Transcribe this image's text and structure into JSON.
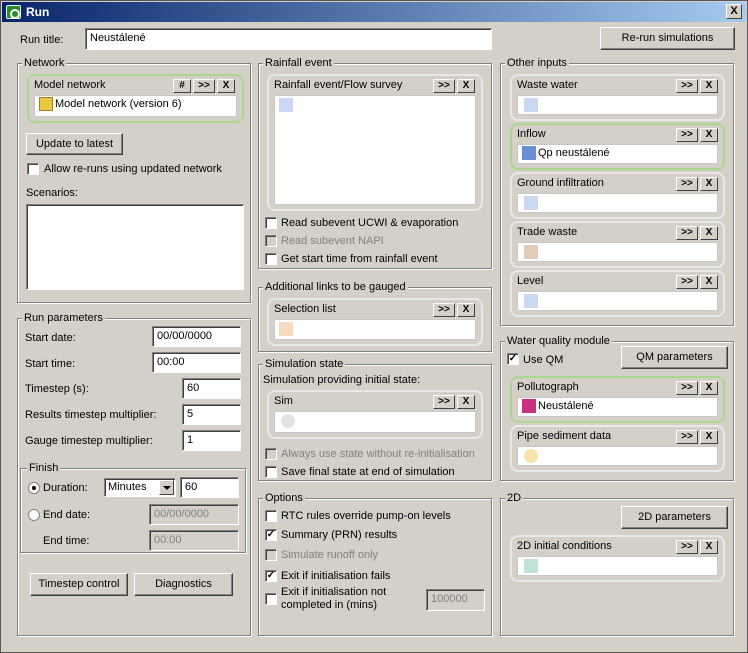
{
  "window": {
    "title": "Run",
    "close": "X"
  },
  "run_title": {
    "label": "Run title:",
    "value": "Neustálené"
  },
  "rerun_button": "Re-run simulations",
  "network": {
    "group_label": "Network",
    "panel_title": "Model network",
    "hash": "#",
    "more": ">>",
    "x": "X",
    "item": "Model network (version 6)",
    "update_button": "Update to latest",
    "allow_reruns": "Allow re-runs using updated network",
    "scenarios_label": "Scenarios:"
  },
  "run_params": {
    "group_label": "Run parameters",
    "start_date_label": "Start date:",
    "start_date": "00/00/0000",
    "start_time_label": "Start time:",
    "start_time": "00:00",
    "timestep_label": "Timestep (s):",
    "timestep": "60",
    "results_mult_label": "Results timestep multiplier:",
    "results_mult": "5",
    "gauge_mult_label": "Gauge timestep multiplier:",
    "gauge_mult": "1",
    "finish_label": "Finish",
    "duration_label": "Duration:",
    "duration_unit": "Minutes",
    "duration_value": "60",
    "end_date_label": "End date:",
    "end_date": "00/00/0000",
    "end_time_label": "End time:",
    "end_time": "00:00",
    "timestep_control": "Timestep control",
    "diagnostics": "Diagnostics"
  },
  "rainfall": {
    "group_label": "Rainfall event",
    "panel_title": "Rainfall event/Flow survey",
    "more": ">>",
    "x": "X",
    "read_ucwi": "Read subevent UCWI & evaporation",
    "read_napi": "Read subevent NAPI",
    "get_start": "Get start time from rainfall event"
  },
  "links": {
    "group_label": "Additional links to be gauged",
    "panel_title": "Selection list",
    "more": ">>",
    "x": "X"
  },
  "sim_state": {
    "group_label": "Simulation state",
    "providing_label": "Simulation providing initial state:",
    "panel_title": "Sim",
    "more": ">>",
    "x": "X",
    "always_use": "Always use state without re-initialisation",
    "save_final": "Save final state at end of simulation"
  },
  "options": {
    "group_label": "Options",
    "rtc": "RTC rules override pump-on levels",
    "summary": "Summary (PRN) results",
    "runoff_only": "Simulate runoff only",
    "exit_fail": "Exit if initialisation fails",
    "exit_not_completed": "Exit if initialisation not completed in (mins)",
    "exit_mins": "100000"
  },
  "other_inputs": {
    "group_label": "Other inputs",
    "more": ">>",
    "x": "X",
    "waste_water": "Waste water",
    "inflow": "Inflow",
    "inflow_item": "Qp neustálené",
    "ground_infiltration": "Ground infiltration",
    "trade_waste": "Trade waste",
    "level": "Level"
  },
  "wq": {
    "group_label": "Water quality module",
    "use_qm": "Use QM",
    "qm_params": "QM parameters",
    "pollutograph": "Pollutograph",
    "pollutograph_item": "Neustálené",
    "pipe_sediment": "Pipe sediment data",
    "more": ">>",
    "x": "X"
  },
  "twod": {
    "group_label": "2D",
    "params_button": "2D parameters",
    "initial_conditions": "2D initial conditions",
    "more": ">>",
    "x": "X"
  }
}
